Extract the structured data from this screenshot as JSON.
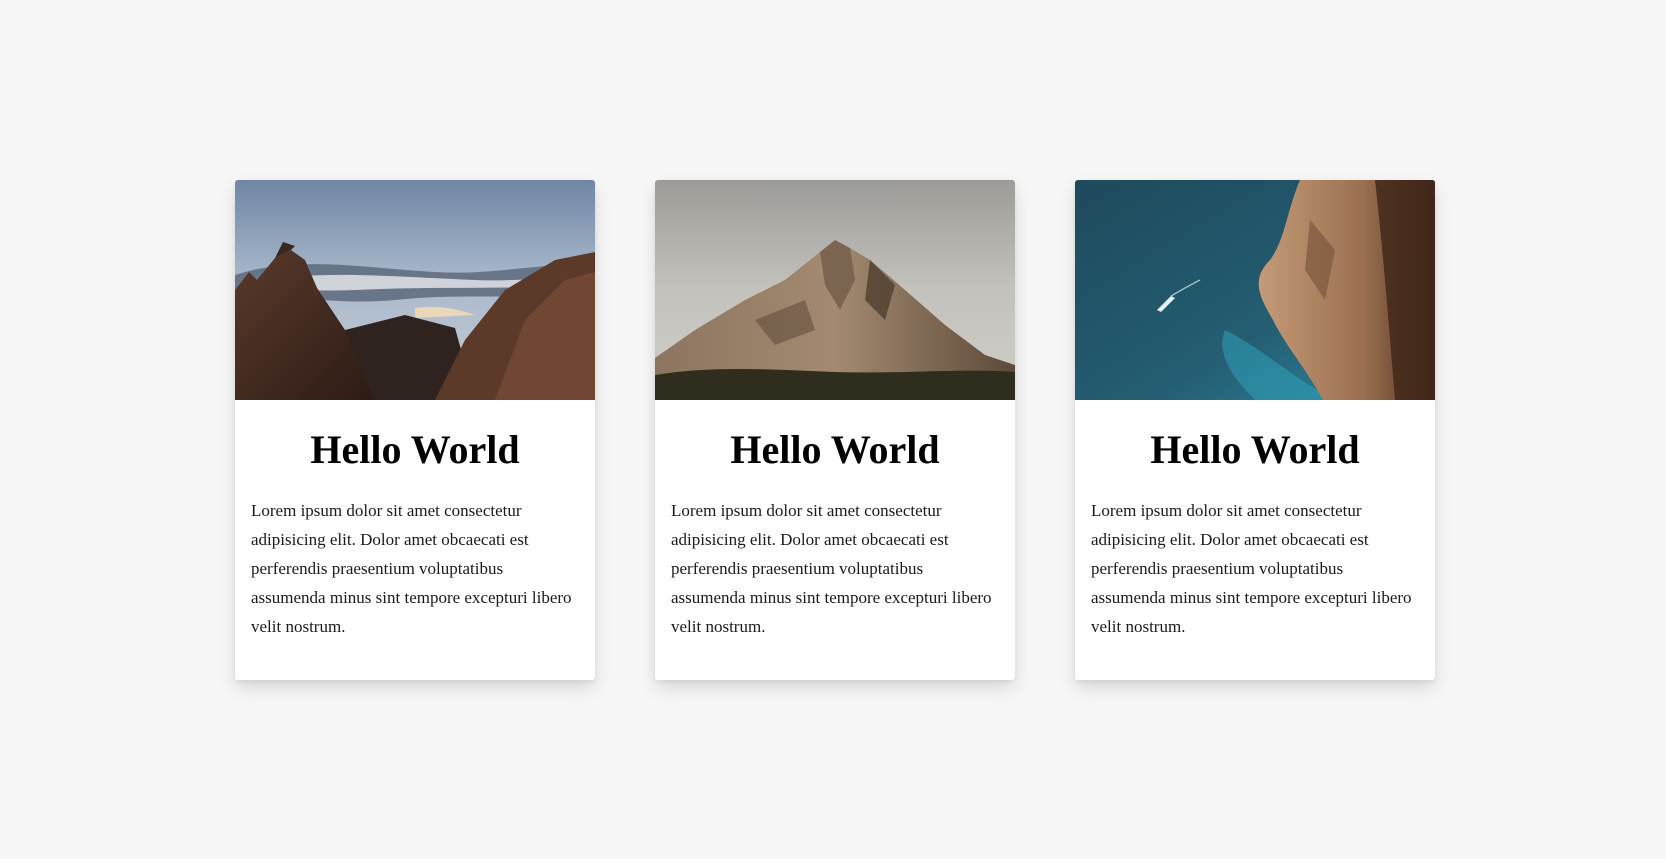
{
  "cards": [
    {
      "title": "Hello World",
      "text": "Lorem ipsum dolor sit amet consectetur adipisicing elit. Dolor amet obcaecati est perferendis praesentium voluptatibus assumenda minus sint tempore excepturi libero velit nostrum.",
      "image": "mountain-peaks-clouds-photo"
    },
    {
      "title": "Hello World",
      "text": "Lorem ipsum dolor sit amet consectetur adipisicing elit. Dolor amet obcaecati est perferendis praesentium voluptatibus assumenda minus sint tempore excepturi libero velit nostrum.",
      "image": "rocky-mountain-photo"
    },
    {
      "title": "Hello World",
      "text": "Lorem ipsum dolor sit amet consectetur adipisicing elit. Dolor amet obcaecati est perferendis praesentium voluptatibus assumenda minus sint tempore excepturi libero velit nostrum.",
      "image": "coastal-cliff-sea-photo"
    }
  ],
  "colors": {
    "background": "#f7f7f7",
    "card": "#ffffff",
    "title": "#000000",
    "text": "#1a1a1a"
  }
}
